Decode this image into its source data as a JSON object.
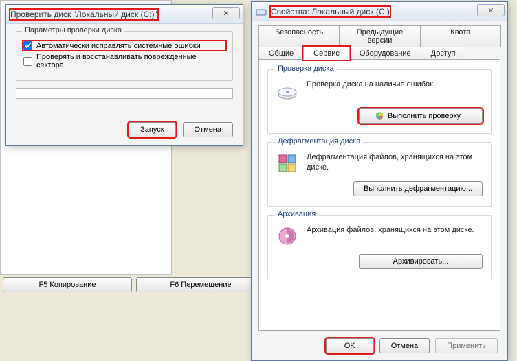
{
  "background": {
    "f5": "F5 Копирование",
    "f6": "F6 Перемещение"
  },
  "checkdisk": {
    "title": "Проверить диск \"Локальный диск (C:)\"",
    "group_label": "Параметры проверки диска",
    "opt_auto": "Автоматически исправлять системные ошибки",
    "opt_scan": "Проверять и восстанавливать поврежденные сектора",
    "start": "Запуск",
    "cancel": "Отмена"
  },
  "props": {
    "title": "Свойства: Локальный диск (C:)",
    "tabs_row1": [
      "Безопасность",
      "Предыдущие версии",
      "Квота"
    ],
    "tabs_row2": [
      "Общие",
      "Сервис",
      "Оборудование",
      "Доступ"
    ],
    "active_tab": "Сервис",
    "sections": {
      "check": {
        "legend": "Проверка диска",
        "text": "Проверка диска на наличие ошибок.",
        "button": "Выполнить проверку..."
      },
      "defrag": {
        "legend": "Дефрагментация диска",
        "text": "Дефрагментация файлов, хранящихся на этом диске.",
        "button": "Выполнить дефрагментацию..."
      },
      "backup": {
        "legend": "Архивация",
        "text": "Архивация файлов, хранящихся на этом диске.",
        "button": "Архивировать..."
      }
    },
    "ok": "OK",
    "cancel": "Отмена",
    "apply": "Применить"
  }
}
